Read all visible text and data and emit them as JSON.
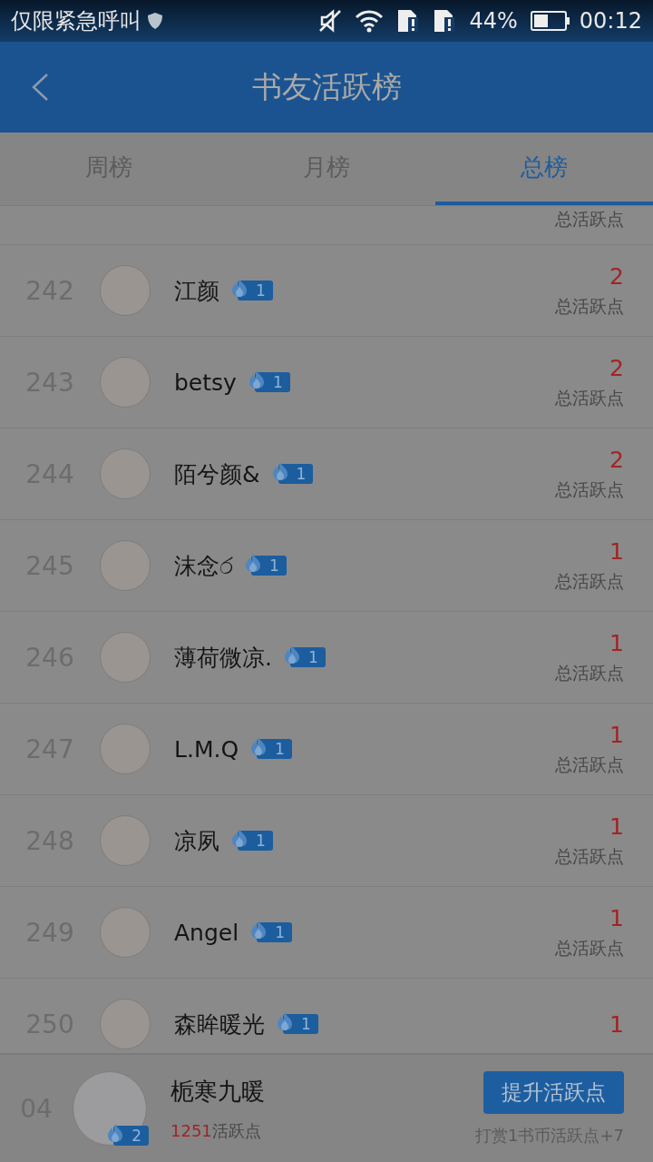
{
  "status_bar": {
    "carrier": "仅限紧急呼叫",
    "battery": "44%",
    "time": "00:12"
  },
  "header": {
    "title": "书友活跃榜"
  },
  "tabs": [
    {
      "label": "周榜",
      "selected": false
    },
    {
      "label": "月榜",
      "selected": false
    },
    {
      "label": "总榜",
      "selected": true
    }
  ],
  "partial_row": {
    "points_label": "总活跃点"
  },
  "rows": [
    {
      "rank": "242",
      "name": "江颜",
      "level": "1",
      "points": "2",
      "points_label": "总活跃点"
    },
    {
      "rank": "243",
      "name": "betsy",
      "level": "1",
      "points": "2",
      "points_label": "总活跃点"
    },
    {
      "rank": "244",
      "name": "陌兮颜&",
      "level": "1",
      "points": "2",
      "points_label": "总活跃点"
    },
    {
      "rank": "245",
      "name": "沫念ර",
      "level": "1",
      "points": "1",
      "points_label": "总活跃点"
    },
    {
      "rank": "246",
      "name": "薄荷微凉.",
      "level": "1",
      "points": "1",
      "points_label": "总活跃点"
    },
    {
      "rank": "247",
      "name": "L.M.Q",
      "level": "1",
      "points": "1",
      "points_label": "总活跃点"
    },
    {
      "rank": "248",
      "name": "凉夙",
      "level": "1",
      "points": "1",
      "points_label": "总活跃点"
    },
    {
      "rank": "249",
      "name": "Angel",
      "level": "1",
      "points": "1",
      "points_label": "总活跃点"
    },
    {
      "rank": "250",
      "name": "森眸暖光",
      "level": "1",
      "points": "1"
    }
  ],
  "footer": {
    "rank": "04",
    "name": "栀寒九暖",
    "level": "2",
    "points": "1251",
    "points_unit": "活跃点",
    "button": "提升活跃点",
    "hint": "打赏1书币活跃点+7"
  }
}
